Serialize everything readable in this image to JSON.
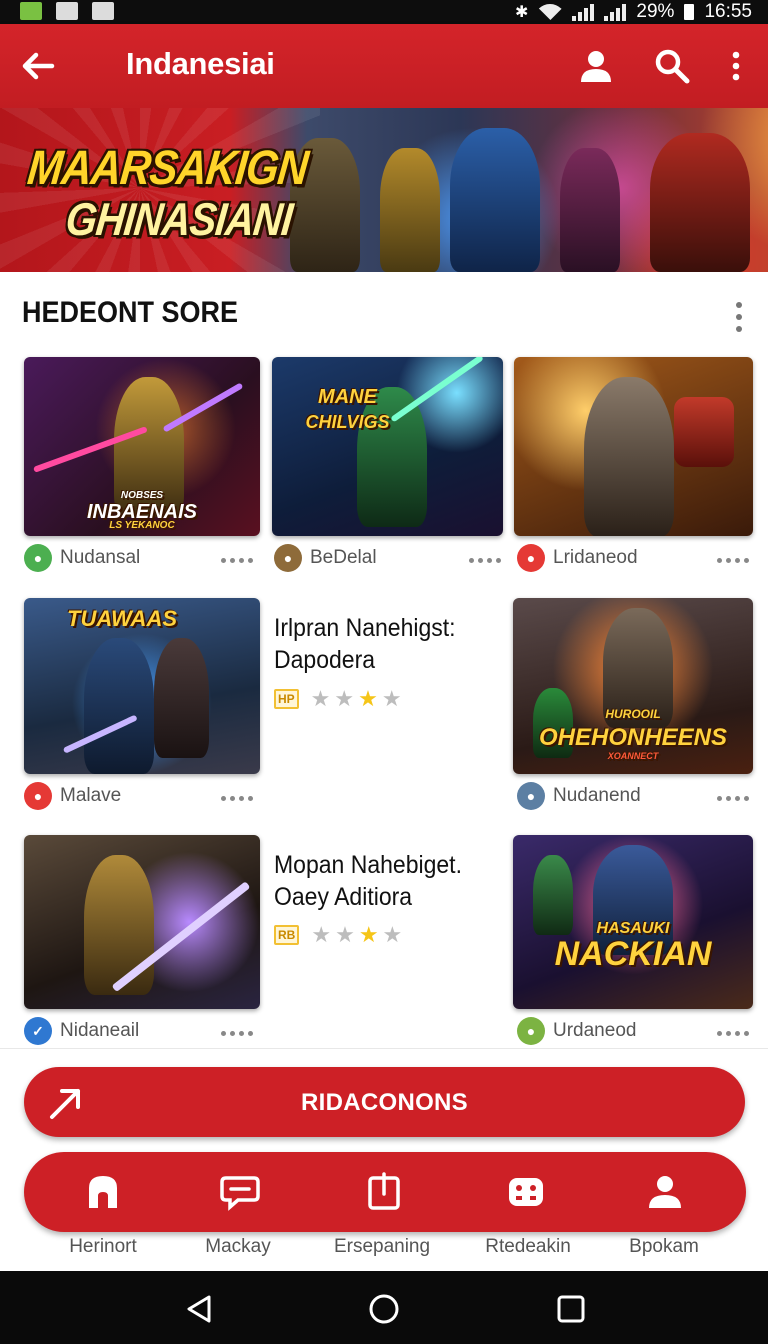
{
  "status_bar": {
    "battery": "29%",
    "time": "16:55"
  },
  "app_bar": {
    "title": "Indanesiai"
  },
  "banner": {
    "line1": "MAARSAKIGN",
    "line2": "GHINASIANI"
  },
  "section": {
    "title": "HEDEONT SORE"
  },
  "games": [
    {
      "name": "Nudansal",
      "icon_color": "#4caf50",
      "art_line1": "NOBSES",
      "art_line2": "INBAENAIS",
      "art_line3": "LS YEKANOC"
    },
    {
      "name": "BeDelal",
      "icon_color": "#8e6b3a",
      "art_line1": "MANE",
      "art_line2": "CHILVIGS"
    },
    {
      "name": "Lridaneod",
      "icon_color": "#e53935"
    },
    {
      "name": "Malave",
      "icon_color": "#e53935",
      "art_line1": "TUAWAAS"
    },
    {
      "name": "Nudanend",
      "icon_color": "#5c7fa3",
      "art_line1": "HUROOIL",
      "art_line2": "OHEHONHEENS",
      "art_line3": "XOANNECT"
    },
    {
      "name": "Nidaneail",
      "icon_color": "#2f78d1"
    },
    {
      "name": "Urdaneod",
      "icon_color": "#7cb342",
      "art_line1": "HASAUKI",
      "art_line2": "NACKIAN"
    }
  ],
  "featured": [
    {
      "title_line1": "Irlpran Nanehigst:",
      "title_line2": "Dapodera",
      "badge": "HP",
      "rating": 3
    },
    {
      "title_line1": "Mopan Nahebiget.",
      "title_line2": "Oaey Aditiora",
      "badge": "RB",
      "rating": 3
    }
  ],
  "cta": {
    "label": "RIDACONONS"
  },
  "bottom_nav": [
    {
      "label": "Herinort",
      "icon": "home-icon"
    },
    {
      "label": "Mackay",
      "icon": "chat-icon"
    },
    {
      "label": "Ersepaning",
      "icon": "share-icon"
    },
    {
      "label": "Rtedeakin",
      "icon": "gamepad-icon"
    },
    {
      "label": "Bpokam",
      "icon": "person-icon"
    }
  ],
  "colors": {
    "primary": "#cd2026",
    "star": "#f5c518"
  }
}
